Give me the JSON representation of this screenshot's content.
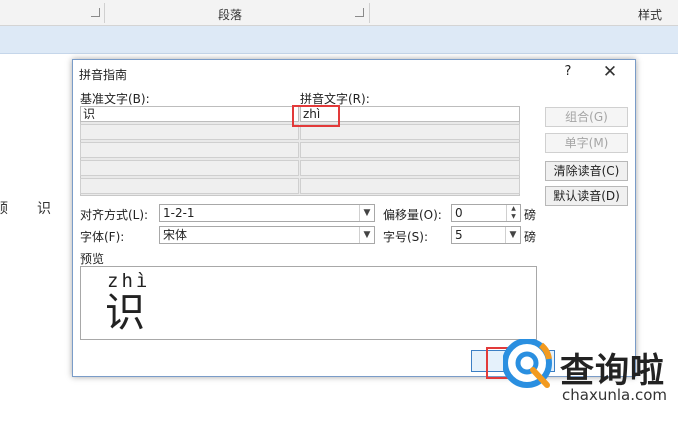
{
  "ribbon": {
    "paragraph_group": "段落",
    "styles_group": "样式"
  },
  "document": {
    "chars": [
      "顺",
      "识"
    ]
  },
  "dialog": {
    "title": "拼音指南",
    "help": "?",
    "close": "✕",
    "base_text_label": "基准文字(B):",
    "ruby_text_label": "拼音文字(R):",
    "rows": [
      {
        "base": "识",
        "ruby": "zhì"
      },
      {
        "base": "",
        "ruby": ""
      },
      {
        "base": "",
        "ruby": ""
      },
      {
        "base": "",
        "ruby": ""
      },
      {
        "base": "",
        "ruby": ""
      }
    ],
    "buttons": {
      "group": "组合(G)",
      "mono": "单字(M)",
      "clear": "清除读音(C)",
      "default": "默认读音(D)"
    },
    "alignment": {
      "label": "对齐方式(L):",
      "value": "1-2-1"
    },
    "offset": {
      "label": "偏移量(O):",
      "value": "0",
      "unit": "磅"
    },
    "font": {
      "label": "字体(F):",
      "value": "宋体"
    },
    "size": {
      "label": "字号(S):",
      "value": "5",
      "unit": "磅"
    },
    "preview": {
      "label": "预览",
      "ruby": "zhì",
      "base": "识"
    },
    "ok_label": "确"
  },
  "watermark": {
    "name": "查询啦",
    "url": "chaxunla.com",
    "colors": {
      "blue": "#2a8fe0",
      "orange": "#f29a1f"
    }
  }
}
